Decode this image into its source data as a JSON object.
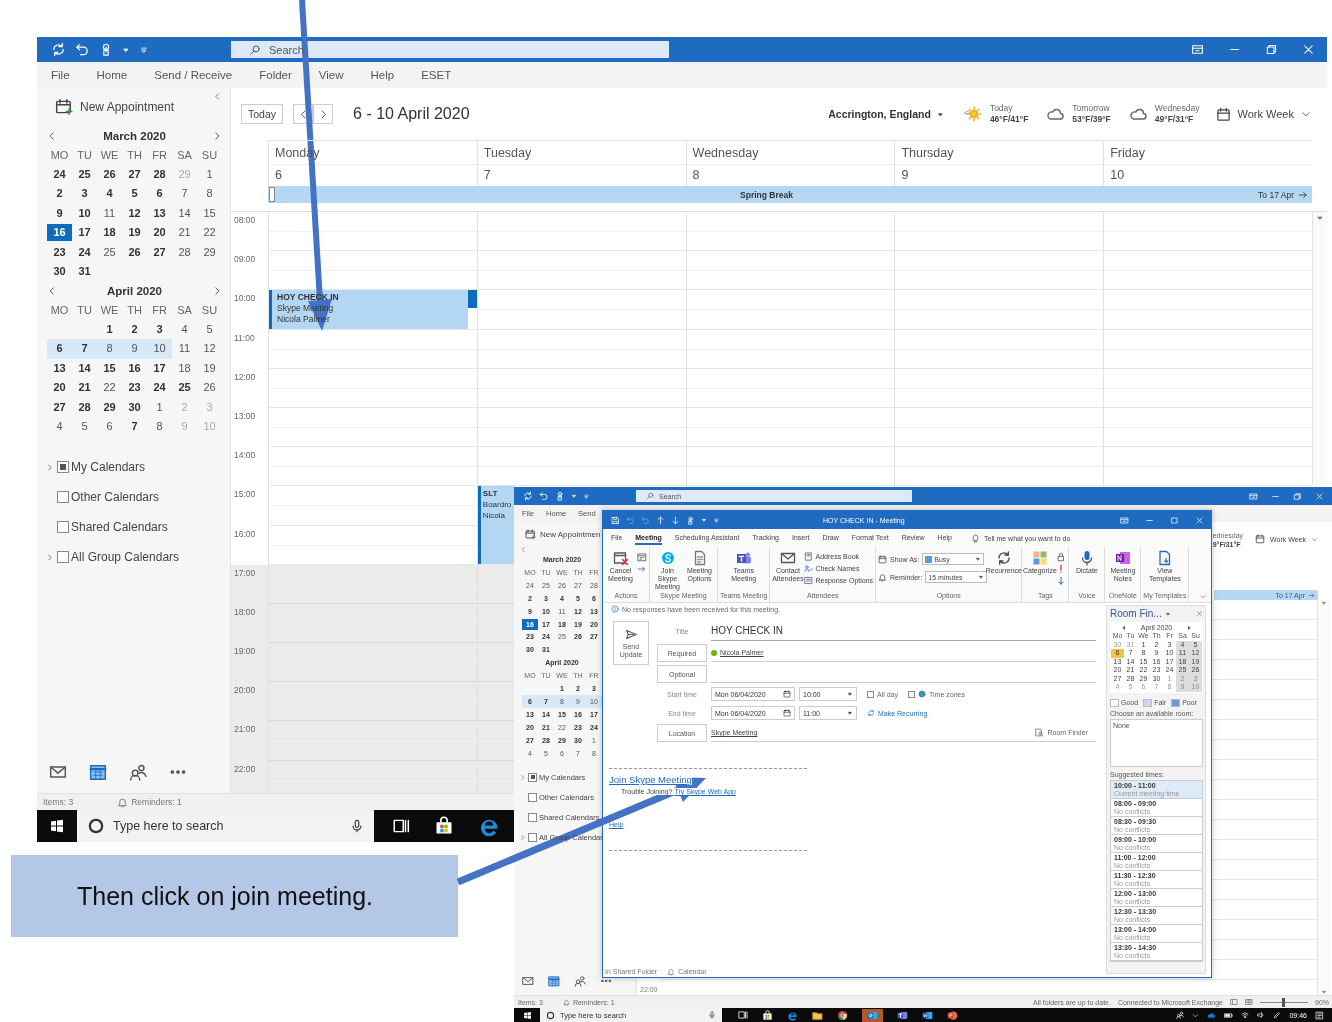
{
  "main": {
    "search": {
      "placeholder": "Search"
    },
    "menu": [
      "File",
      "Home",
      "Send / Receive",
      "Folder",
      "View",
      "Help",
      "ESET"
    ],
    "new_appointment": "New Appointment",
    "mini_calendars": [
      {
        "title": "March 2020",
        "weekdays": [
          "MO",
          "TU",
          "WE",
          "TH",
          "FR",
          "SA",
          "SU"
        ],
        "weeks": [
          {
            "selected": false,
            "days": [
              {
                "day": "24",
                "kind": "bold"
              },
              {
                "day": "25",
                "kind": "bold"
              },
              {
                "day": "26",
                "kind": "bold"
              },
              {
                "day": "27",
                "kind": "bold"
              },
              {
                "day": "28",
                "kind": "bold"
              },
              {
                "day": "29",
                "kind": "faded"
              },
              {
                "day": "1",
                "kind": "plain"
              }
            ]
          },
          {
            "selected": false,
            "days": [
              {
                "day": "2",
                "kind": "bold"
              },
              {
                "day": "3",
                "kind": "bold"
              },
              {
                "day": "4",
                "kind": "bold"
              },
              {
                "day": "5",
                "kind": "bold"
              },
              {
                "day": "6",
                "kind": "bold"
              },
              {
                "day": "7",
                "kind": "plain"
              },
              {
                "day": "8",
                "kind": "plain"
              }
            ]
          },
          {
            "selected": false,
            "days": [
              {
                "day": "9",
                "kind": "bold"
              },
              {
                "day": "10",
                "kind": "bold"
              },
              {
                "day": "11",
                "kind": "plain"
              },
              {
                "day": "12",
                "kind": "bold"
              },
              {
                "day": "13",
                "kind": "bold"
              },
              {
                "day": "14",
                "kind": "plain"
              },
              {
                "day": "15",
                "kind": "plain"
              }
            ]
          },
          {
            "selected": false,
            "days": [
              {
                "day": "16",
                "kind": "today"
              },
              {
                "day": "17",
                "kind": "bold"
              },
              {
                "day": "18",
                "kind": "bold"
              },
              {
                "day": "19",
                "kind": "bold"
              },
              {
                "day": "20",
                "kind": "bold"
              },
              {
                "day": "21",
                "kind": "plain"
              },
              {
                "day": "22",
                "kind": "plain"
              }
            ]
          },
          {
            "selected": false,
            "days": [
              {
                "day": "23",
                "kind": "bold"
              },
              {
                "day": "24",
                "kind": "bold"
              },
              {
                "day": "25",
                "kind": "plain"
              },
              {
                "day": "26",
                "kind": "bold"
              },
              {
                "day": "27",
                "kind": "bold"
              },
              {
                "day": "28",
                "kind": "plain"
              },
              {
                "day": "29",
                "kind": "plain"
              }
            ]
          },
          {
            "selected": false,
            "days": [
              {
                "day": "30",
                "kind": "bold"
              },
              {
                "day": "31",
                "kind": "bold"
              }
            ]
          }
        ]
      },
      {
        "title": "April 2020",
        "weekdays": [
          "MO",
          "TU",
          "WE",
          "TH",
          "FR",
          "SA",
          "SU"
        ],
        "weeks": [
          {
            "selected": false,
            "days": [
              {
                "kind": "blank"
              },
              {
                "kind": "blank"
              },
              {
                "day": "1",
                "kind": "bold"
              },
              {
                "day": "2",
                "kind": "bold"
              },
              {
                "day": "3",
                "kind": "bold"
              },
              {
                "day": "4",
                "kind": "plain"
              },
              {
                "day": "5",
                "kind": "plain"
              }
            ]
          },
          {
            "selected": true,
            "days": [
              {
                "day": "6",
                "kind": "bold"
              },
              {
                "day": "7",
                "kind": "bold"
              },
              {
                "day": "8",
                "kind": "plain"
              },
              {
                "day": "9",
                "kind": "plain"
              },
              {
                "day": "10",
                "kind": "plain"
              },
              {
                "day": "11",
                "kind": "plain"
              },
              {
                "day": "12",
                "kind": "plain"
              }
            ]
          },
          {
            "selected": false,
            "days": [
              {
                "day": "13",
                "kind": "bold"
              },
              {
                "day": "14",
                "kind": "bold"
              },
              {
                "day": "15",
                "kind": "bold"
              },
              {
                "day": "16",
                "kind": "bold"
              },
              {
                "day": "17",
                "kind": "bold"
              },
              {
                "day": "18",
                "kind": "plain"
              },
              {
                "day": "19",
                "kind": "plain"
              }
            ]
          },
          {
            "selected": false,
            "days": [
              {
                "day": "20",
                "kind": "bold"
              },
              {
                "day": "21",
                "kind": "bold"
              },
              {
                "day": "22",
                "kind": "plain"
              },
              {
                "day": "23",
                "kind": "bold"
              },
              {
                "day": "24",
                "kind": "bold"
              },
              {
                "day": "25",
                "kind": "bold"
              },
              {
                "day": "26",
                "kind": "plain"
              }
            ]
          },
          {
            "selected": false,
            "days": [
              {
                "day": "27",
                "kind": "bold"
              },
              {
                "day": "28",
                "kind": "bold"
              },
              {
                "day": "29",
                "kind": "bold"
              },
              {
                "day": "30",
                "kind": "bold"
              },
              {
                "day": "1",
                "kind": "plain"
              },
              {
                "day": "2",
                "kind": "faded"
              },
              {
                "day": "3",
                "kind": "faded"
              }
            ]
          },
          {
            "selected": false,
            "days": [
              {
                "day": "4",
                "kind": "plain"
              },
              {
                "day": "5",
                "kind": "plain"
              },
              {
                "day": "6",
                "kind": "plain"
              },
              {
                "day": "7",
                "kind": "bold"
              },
              {
                "day": "8",
                "kind": "plain"
              },
              {
                "day": "9",
                "kind": "faded"
              },
              {
                "day": "10",
                "kind": "faded"
              }
            ]
          }
        ]
      }
    ],
    "folders": [
      {
        "label": "My Calendars",
        "checked": true,
        "expandable": true
      },
      {
        "label": "Other Calendars",
        "checked": false,
        "expandable": false
      },
      {
        "label": "Shared Calendars",
        "checked": false,
        "expandable": false
      },
      {
        "label": "All Group Calendars",
        "checked": false,
        "expandable": true
      }
    ],
    "calendar": {
      "today_button": "Today",
      "range": "6 - 10 April 2020",
      "location": "Accrington, England",
      "weather": [
        {
          "day": "Today",
          "temps": "46°F/41°F",
          "kind": "sun"
        },
        {
          "day": "Tomorrow",
          "temps": "53°F/39°F",
          "kind": "cloud"
        },
        {
          "day": "Wednesday",
          "temps": "49°F/31°F",
          "kind": "cloud"
        }
      ],
      "view": "Work Week",
      "all_day": {
        "title": "Spring Break",
        "until": "To 17 Apr"
      },
      "hours": [
        {
          "label": "08:00",
          "working": true
        },
        {
          "label": "09:00",
          "working": true
        },
        {
          "label": "10:00",
          "working": true
        },
        {
          "label": "11:00",
          "working": true
        },
        {
          "label": "12:00",
          "working": true
        },
        {
          "label": "13:00",
          "working": true
        },
        {
          "label": "14:00",
          "working": true
        },
        {
          "label": "15:00",
          "working": true
        },
        {
          "label": "16:00",
          "working": true
        },
        {
          "label": "17:00",
          "working": false
        },
        {
          "label": "18:00",
          "working": false
        },
        {
          "label": "19:00",
          "working": false
        },
        {
          "label": "20:00",
          "working": false
        },
        {
          "label": "21:00",
          "working": false
        },
        {
          "label": "22:00",
          "working": false
        }
      ],
      "days": [
        {
          "name": "Monday",
          "date": "6",
          "slots": [
            {
              "kind": "free"
            },
            {
              "kind": "free"
            },
            {
              "kind": "event",
              "title": "HOY CHECK IN",
              "lines": [
                "Skype Meeting",
                "Nicola Palmer"
              ]
            },
            {
              "kind": "free"
            },
            {
              "kind": "free"
            },
            {
              "kind": "free"
            },
            {
              "kind": "free"
            },
            {
              "kind": "free"
            },
            {
              "kind": "free"
            },
            {
              "kind": "free"
            },
            {
              "kind": "free"
            },
            {
              "kind": "free"
            },
            {
              "kind": "free"
            },
            {
              "kind": "free"
            },
            {
              "kind": "free"
            }
          ]
        },
        {
          "name": "Tuesday",
          "date": "7",
          "slots": [
            {
              "kind": "free"
            },
            {
              "kind": "free"
            },
            {
              "kind": "free"
            },
            {
              "kind": "free"
            },
            {
              "kind": "free"
            },
            {
              "kind": "free"
            },
            {
              "kind": "free"
            },
            {
              "kind": "event",
              "title": "SLT",
              "lines": [
                "Boardro",
                "Nicola"
              ]
            },
            {
              "kind": "continued"
            },
            {
              "kind": "free"
            },
            {
              "kind": "free"
            },
            {
              "kind": "free"
            },
            {
              "kind": "free"
            },
            {
              "kind": "free"
            },
            {
              "kind": "free"
            }
          ]
        },
        {
          "name": "Wednesday",
          "date": "8",
          "slots": [
            {
              "kind": "free"
            },
            {
              "kind": "free"
            },
            {
              "kind": "free"
            },
            {
              "kind": "free"
            },
            {
              "kind": "free"
            },
            {
              "kind": "free"
            },
            {
              "kind": "free"
            }
          ]
        },
        {
          "name": "Thursday",
          "date": "9",
          "slots": [
            {
              "kind": "free"
            },
            {
              "kind": "free"
            },
            {
              "kind": "free"
            },
            {
              "kind": "free"
            },
            {
              "kind": "free"
            },
            {
              "kind": "free"
            },
            {
              "kind": "free"
            }
          ]
        },
        {
          "name": "Friday",
          "date": "10",
          "slots": [
            {
              "kind": "free"
            },
            {
              "kind": "free"
            },
            {
              "kind": "free"
            },
            {
              "kind": "free"
            },
            {
              "kind": "free"
            },
            {
              "kind": "free"
            },
            {
              "kind": "free"
            }
          ]
        }
      ]
    },
    "status": {
      "items": "Items: 3",
      "reminders": "Reminders: 1"
    },
    "taskbar": {
      "search_placeholder": "Type here to search"
    }
  },
  "back": {
    "search": {
      "placeholder": "Search"
    },
    "menu": [
      "File",
      "Home",
      "Send"
    ],
    "new_appointment": "New Appointmen",
    "mini_calendars": [
      {
        "title": "March 2020",
        "weekdays": [
          "MO",
          "TU",
          "WE",
          "TH",
          "FR"
        ],
        "weeks": [
          {
            "selected": false,
            "days": [
              {
                "day": "24",
                "kind": "plain"
              },
              {
                "day": "25",
                "kind": "plain"
              },
              {
                "day": "26",
                "kind": "plain"
              },
              {
                "day": "27",
                "kind": "plain"
              },
              {
                "day": "28",
                "kind": "plain"
              }
            ]
          },
          {
            "selected": false,
            "days": [
              {
                "day": "2",
                "kind": "bold"
              },
              {
                "day": "3",
                "kind": "bold"
              },
              {
                "day": "4",
                "kind": "bold"
              },
              {
                "day": "5",
                "kind": "bold"
              },
              {
                "day": "6",
                "kind": "bold"
              }
            ]
          },
          {
            "selected": false,
            "days": [
              {
                "day": "9",
                "kind": "bold"
              },
              {
                "day": "10",
                "kind": "bold"
              },
              {
                "day": "11",
                "kind": "plain"
              },
              {
                "day": "12",
                "kind": "bold"
              },
              {
                "day": "13",
                "kind": "bold"
              }
            ]
          },
          {
            "selected": false,
            "days": [
              {
                "day": "16",
                "kind": "today"
              },
              {
                "day": "17",
                "kind": "bold"
              },
              {
                "day": "18",
                "kind": "bold"
              },
              {
                "day": "19",
                "kind": "bold"
              },
              {
                "day": "20",
                "kind": "bold"
              }
            ]
          },
          {
            "selected": false,
            "days": [
              {
                "day": "23",
                "kind": "bold"
              },
              {
                "day": "24",
                "kind": "bold"
              },
              {
                "day": "25",
                "kind": "plain"
              },
              {
                "day": "26",
                "kind": "bold"
              },
              {
                "day": "27",
                "kind": "bold"
              }
            ]
          },
          {
            "selected": false,
            "days": [
              {
                "day": "30",
                "kind": "bold"
              },
              {
                "day": "31",
                "kind": "bold"
              }
            ]
          }
        ]
      },
      {
        "title": "April 2020",
        "weekdays": [
          "MO",
          "TU",
          "WE",
          "TH",
          "FR"
        ],
        "weeks": [
          {
            "selected": false,
            "days": [
              {
                "kind": "blank"
              },
              {
                "kind": "blank"
              },
              {
                "day": "1",
                "kind": "bold"
              },
              {
                "day": "2",
                "kind": "bold"
              },
              {
                "day": "3",
                "kind": "bold"
              }
            ]
          },
          {
            "selected": true,
            "days": [
              {
                "day": "6",
                "kind": "bold"
              },
              {
                "day": "7",
                "kind": "bold"
              },
              {
                "day": "8",
                "kind": "plain"
              },
              {
                "day": "9",
                "kind": "plain"
              },
              {
                "day": "10",
                "kind": "plain"
              }
            ]
          },
          {
            "selected": false,
            "days": [
              {
                "day": "13",
                "kind": "bold"
              },
              {
                "day": "14",
                "kind": "bold"
              },
              {
                "day": "15",
                "kind": "bold"
              },
              {
                "day": "16",
                "kind": "bold"
              },
              {
                "day": "17",
                "kind": "bold"
              }
            ]
          },
          {
            "selected": false,
            "days": [
              {
                "day": "20",
                "kind": "bold"
              },
              {
                "day": "21",
                "kind": "bold"
              },
              {
                "day": "22",
                "kind": "plain"
              },
              {
                "day": "23",
                "kind": "bold"
              },
              {
                "day": "24",
                "kind": "bold"
              }
            ]
          },
          {
            "selected": false,
            "days": [
              {
                "day": "27",
                "kind": "bold"
              },
              {
                "day": "28",
                "kind": "bold"
              },
              {
                "day": "29",
                "kind": "bold"
              },
              {
                "day": "30",
                "kind": "bold"
              },
              {
                "day": "1",
                "kind": "plain"
              }
            ]
          },
          {
            "selected": false,
            "days": [
              {
                "day": "4",
                "kind": "plain"
              },
              {
                "day": "5",
                "kind": "plain"
              },
              {
                "day": "6",
                "kind": "plain"
              },
              {
                "day": "7",
                "kind": "plain"
              },
              {
                "day": "8",
                "kind": "plain"
              }
            ]
          }
        ]
      }
    ],
    "folders": [
      {
        "label": "My Calendars",
        "checked": true,
        "expandable": true
      },
      {
        "label": "Other Calendars",
        "checked": false,
        "expandable": false
      },
      {
        "label": "Shared Calendars",
        "checked": false,
        "expandable": false
      },
      {
        "label": "All Group Calendar",
        "checked": false,
        "expandable": true
      }
    ],
    "weather_day": "ednesday",
    "weather_temps": "9°F/31°F",
    "view": "Work Week",
    "until": "To 17 Apr",
    "hour_label": "22:00",
    "status": {
      "items": "Items: 3",
      "reminders": "Reminders: 1",
      "sync": "All folders are up to date.",
      "connection": "Connected to Microsoft Exchange",
      "zoom_slider": {
        "level": 0.45
      },
      "zoom": "90%"
    },
    "taskbar": {
      "search_placeholder": "Type here to search",
      "time": "09:46"
    }
  },
  "meeting": {
    "title": "HOY CHECK IN  -  Meeting",
    "tabs": [
      {
        "label": "File",
        "selected": false
      },
      {
        "label": "Meeting",
        "selected": true
      },
      {
        "label": "Scheduling Assistant",
        "selected": false
      },
      {
        "label": "Tracking",
        "selected": false
      },
      {
        "label": "Insert",
        "selected": false
      },
      {
        "label": "Draw",
        "selected": false
      },
      {
        "label": "Format Text",
        "selected": false
      },
      {
        "label": "Review",
        "selected": false
      },
      {
        "label": "Help",
        "selected": false
      }
    ],
    "tell_me": "Tell me what you want to do",
    "ribbon": [
      {
        "label": "Actions",
        "kind": "buttons",
        "buttons": [
          {
            "label": "Cancel Meeting",
            "kind": "cancel"
          }
        ],
        "small": [
          {
            "kind": "calendar"
          },
          {
            "kind": "forward"
          }
        ]
      },
      {
        "label": "Skype Meeting",
        "kind": "buttons",
        "buttons": [
          {
            "label": "Join Skype Meeting",
            "kind": "skype"
          },
          {
            "label": "Meeting Options",
            "kind": "document"
          }
        ]
      },
      {
        "label": "Teams Meeting",
        "kind": "buttons",
        "buttons": [
          {
            "label": "Teams Meeting",
            "kind": "teams"
          }
        ]
      },
      {
        "label": "Attendees",
        "kind": "buttons",
        "buttons": [
          {
            "label": "Contact Attendees",
            "kind": "envelope"
          }
        ],
        "small": [
          {
            "label": "Address Book",
            "kind": "book"
          },
          {
            "label": "Check Names",
            "kind": "names"
          },
          {
            "label": "Response Options",
            "kind": "response"
          }
        ]
      },
      {
        "label": "Options",
        "kind": "options",
        "show_as": {
          "label": "Show As:",
          "value": "Busy"
        },
        "reminder": {
          "label": "Reminder:",
          "value": "15 minutes"
        },
        "buttons": [
          {
            "label": "Recurrence",
            "kind": "recurrence"
          }
        ]
      },
      {
        "label": "Tags",
        "kind": "buttons",
        "buttons": [
          {
            "label": "Categorize",
            "kind": "categorize"
          }
        ],
        "small": [
          {
            "kind": "lock"
          },
          {
            "kind": "importance"
          },
          {
            "kind": "low"
          }
        ]
      },
      {
        "label": "Voice",
        "kind": "buttons",
        "buttons": [
          {
            "label": "Dictate",
            "kind": "microphone"
          }
        ]
      },
      {
        "label": "OneNote",
        "kind": "buttons",
        "buttons": [
          {
            "label": "Meeting Notes",
            "kind": "notes"
          }
        ]
      },
      {
        "label": "My Templates",
        "kind": "buttons",
        "buttons": [
          {
            "label": "View Templates",
            "kind": "templates"
          }
        ]
      }
    ],
    "info": "No responses have been received for this meeting.",
    "send": "Send Update",
    "form": {
      "title_label": "Title",
      "title": "HOY CHECK IN",
      "required": "Required",
      "attendee": "Nicola Palmer",
      "optional": "Optional",
      "start_label": "Start time",
      "start_date": "Mon 06/04/2020",
      "start_time": "10:00",
      "all_day": {
        "label": "All day",
        "checked": false
      },
      "time_zones": {
        "label": "Time zones",
        "checked": false
      },
      "end_label": "End time",
      "end_date": "Mon 06/04/2020",
      "end_time": "11:00",
      "recurring": "Make Recurring",
      "location_button": "Location",
      "location": "Skype Meeting",
      "room_finder": "Room Finder"
    },
    "body": {
      "join": "Join Skype Meeting",
      "trouble": "Trouble Joining?",
      "web_app": "Try Skype Web App",
      "help": "Help"
    },
    "footer": {
      "folder": "In Shared Folder",
      "calendar": "Calendar"
    },
    "room_finder": {
      "title": "Room Fin...",
      "month": "April 2020",
      "weekdays": [
        "Mo",
        "Tu",
        "We",
        "Th",
        "Fr",
        "Sa",
        "Su"
      ],
      "weeks": [
        [
          {
            "day": "30",
            "kind": "faded"
          },
          {
            "day": "31",
            "kind": "faded"
          },
          {
            "day": "1",
            "kind": "plain"
          },
          {
            "day": "2",
            "kind": "plain"
          },
          {
            "day": "3",
            "kind": "plain"
          },
          {
            "day": "4",
            "kind": "weekend"
          },
          {
            "day": "5",
            "kind": "weekend"
          }
        ],
        [
          {
            "day": "6",
            "kind": "chosen"
          },
          {
            "day": "7",
            "kind": "plain"
          },
          {
            "day": "8",
            "kind": "plain"
          },
          {
            "day": "9",
            "kind": "plain"
          },
          {
            "day": "10",
            "kind": "plain"
          },
          {
            "day": "11",
            "kind": "weekend"
          },
          {
            "day": "12",
            "kind": "weekend"
          }
        ],
        [
          {
            "day": "13",
            "kind": "plain"
          },
          {
            "day": "14",
            "kind": "plain"
          },
          {
            "day": "15",
            "kind": "plain"
          },
          {
            "day": "16",
            "kind": "plain"
          },
          {
            "day": "17",
            "kind": "plain"
          },
          {
            "day": "18",
            "kind": "weekend"
          },
          {
            "day": "19",
            "kind": "weekend"
          }
        ],
        [
          {
            "day": "20",
            "kind": "plain"
          },
          {
            "day": "21",
            "kind": "plain"
          },
          {
            "day": "22",
            "kind": "plain"
          },
          {
            "day": "23",
            "kind": "plain"
          },
          {
            "day": "24",
            "kind": "plain"
          },
          {
            "day": "25",
            "kind": "weekend"
          },
          {
            "day": "26",
            "kind": "weekend"
          }
        ],
        [
          {
            "day": "27",
            "kind": "plain"
          },
          {
            "day": "28",
            "kind": "plain"
          },
          {
            "day": "29",
            "kind": "plain"
          },
          {
            "day": "30",
            "kind": "plain"
          },
          {
            "day": "1",
            "kind": "faded"
          },
          {
            "day": "2",
            "kind": "weekend_faded"
          },
          {
            "day": "3",
            "kind": "weekend_faded"
          }
        ],
        [
          {
            "day": "4",
            "kind": "faded"
          },
          {
            "day": "5",
            "kind": "faded"
          },
          {
            "day": "6",
            "kind": "faded"
          },
          {
            "day": "7",
            "kind": "faded"
          },
          {
            "day": "8",
            "kind": "faded"
          },
          {
            "day": "9",
            "kind": "weekend_faded"
          },
          {
            "day": "10",
            "kind": "weekend_faded"
          }
        ]
      ],
      "legend": [
        {
          "label": "Good",
          "color": "#ffffff"
        },
        {
          "label": "Fair",
          "color": "#c6dbf3"
        },
        {
          "label": "Poor",
          "color": "#6e9bd6"
        }
      ],
      "rooms_label": "Choose an available room:",
      "rooms": [
        "None"
      ],
      "suggested_label": "Suggested times:",
      "suggestions": [
        {
          "time": "10:00 - 11:00",
          "note": "Current meeting time",
          "selected": true
        },
        {
          "time": "08:00 - 09:00",
          "note": "No conflicts",
          "selected": false
        },
        {
          "time": "08:30 - 09:30",
          "note": "No conflicts",
          "selected": false
        },
        {
          "time": "09:00 - 10:00",
          "note": "No conflicts",
          "selected": false
        },
        {
          "time": "11:00 - 12:00",
          "note": "No conflicts",
          "selected": false
        },
        {
          "time": "11:30 - 12:30",
          "note": "No conflicts",
          "selected": false
        },
        {
          "time": "12:00 - 13:00",
          "note": "No conflicts",
          "selected": false
        },
        {
          "time": "12:30 - 13:30",
          "note": "No conflicts",
          "selected": false
        },
        {
          "time": "13:00 - 14:00",
          "note": "No conflicts",
          "selected": false
        },
        {
          "time": "13:30 - 14:30",
          "note": "No conflicts",
          "selected": false
        }
      ]
    }
  },
  "callout": "Then click on join meeting."
}
